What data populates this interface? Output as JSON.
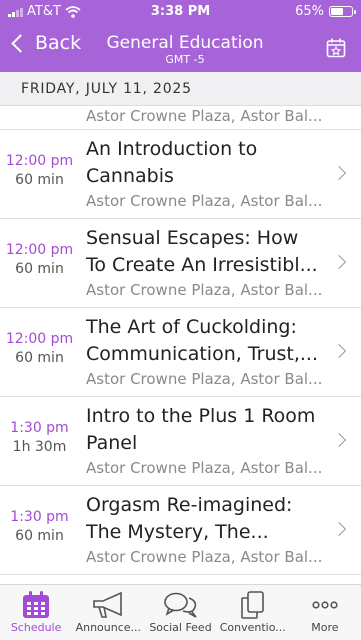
{
  "status_bar": {
    "carrier": "AT&T",
    "time": "3:38 PM",
    "battery_percent": "65%",
    "battery_level": 0.65
  },
  "nav": {
    "back_label": "Back",
    "title": "General Education",
    "subtitle": "GMT -5"
  },
  "date_header": "FRIDAY, JULY 11, 2025",
  "partial_row": {
    "location": "Astor Crowne Plaza, Astor Bal..."
  },
  "sessions": [
    {
      "start": "12:00 pm",
      "duration": "60 min",
      "title_line1": "An Introduction to",
      "title_line2": "Cannabis",
      "location": "Astor Crowne Plaza, Astor Bal..."
    },
    {
      "start": "12:00 pm",
      "duration": "60 min",
      "title_line1": "Sensual Escapes: How",
      "title_line2": "To Create An Irresistibl...",
      "location": "Astor Crowne Plaza, Astor Bal..."
    },
    {
      "start": "12:00 pm",
      "duration": "60 min",
      "title_line1": "The Art of Cuckolding:",
      "title_line2": "Communication, Trust,...",
      "location": "Astor Crowne Plaza, Astor Bal..."
    },
    {
      "start": "1:30 pm",
      "duration": "1h 30m",
      "title_line1": "Intro to the Plus 1 Room",
      "title_line2": "Panel",
      "location": "Astor Crowne Plaza, Astor Bal..."
    },
    {
      "start": "1:30 pm",
      "duration": "60 min",
      "title_line1": "Orgasm Re-imagined:",
      "title_line2": "The Mystery, The...",
      "location": "Astor Crowne Plaza, Astor Bal..."
    }
  ],
  "tabs": [
    {
      "label": "Schedule",
      "icon": "calendar-icon",
      "active": true
    },
    {
      "label": "Announce...",
      "icon": "megaphone-icon",
      "active": false
    },
    {
      "label": "Social Feed",
      "icon": "chat-bubbles-icon",
      "active": false
    },
    {
      "label": "Conventio...",
      "icon": "documents-icon",
      "active": false
    },
    {
      "label": "More",
      "icon": "more-dots-icon",
      "active": false
    }
  ],
  "colors": {
    "header_bg": "#a764d8",
    "accent": "#a34bd6"
  }
}
